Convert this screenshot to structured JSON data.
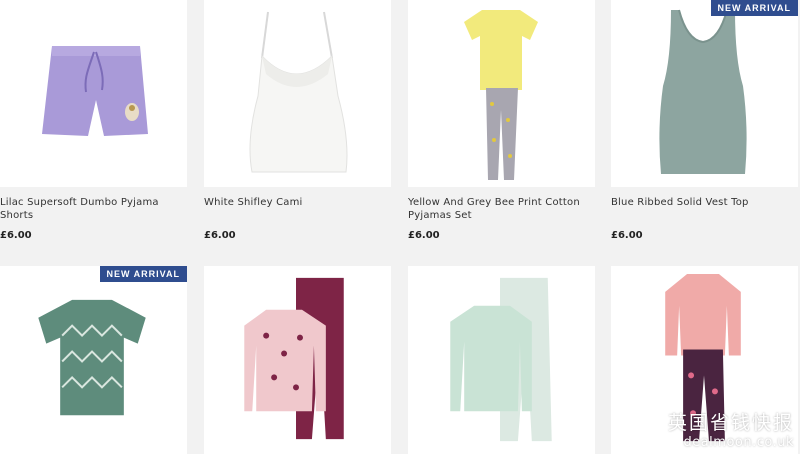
{
  "products": [
    {
      "name": "Lilac Supersoft Dumbo Pyjama Shorts",
      "price": "£6.00",
      "badge": "",
      "image_icon": "lilac-pyjama-shorts-image"
    },
    {
      "name": "White Shifley Cami",
      "price": "£6.00",
      "badge": "",
      "image_icon": "white-cami-image"
    },
    {
      "name": "Yellow And Grey Bee Print Cotton Pyjamas Set",
      "price": "£6.00",
      "badge": "",
      "image_icon": "yellow-grey-pyjama-set-image"
    },
    {
      "name": "Blue Ribbed Solid Vest Top",
      "price": "£6.00",
      "badge": "NEW ARRIVAL",
      "image_icon": "blue-vest-top-image"
    },
    {
      "name": "",
      "price": "",
      "badge": "NEW ARRIVAL",
      "image_icon": "green-print-tshirt-image"
    },
    {
      "name": "",
      "price": "",
      "badge": "",
      "image_icon": "pink-burgundy-pyjama-set-image"
    },
    {
      "name": "",
      "price": "",
      "badge": "",
      "image_icon": "mint-pyjama-set-image"
    },
    {
      "name": "",
      "price": "",
      "badge": "",
      "image_icon": "pink-floral-pyjama-set-image"
    }
  ],
  "watermark": {
    "cn": "英国省钱快报",
    "en": "dealmoon.co.uk"
  },
  "colors": {
    "badge": "#2f4d8f",
    "card_bg": "#ffffff",
    "page_bg": "#f2f2f2"
  }
}
